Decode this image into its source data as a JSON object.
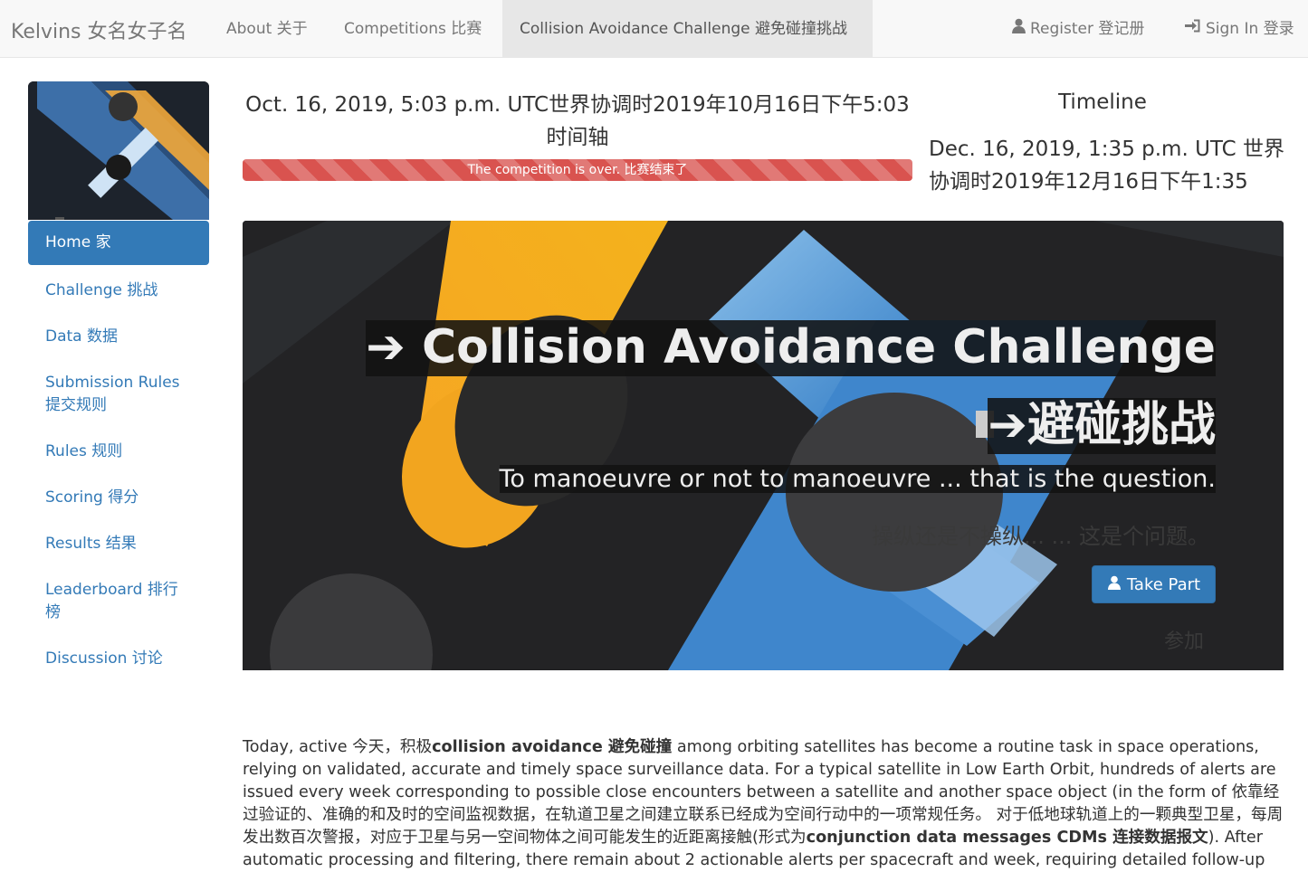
{
  "navbar": {
    "brand": "Kelvins 女名女子名",
    "about": "About 关于",
    "competitions": "Competitions 比赛",
    "current": "Collision Avoidance Challenge 避免碰撞挑战",
    "register": "Register 登记册",
    "sign_in": "Sign In 登录"
  },
  "sidebar": {
    "items": [
      {
        "label": "Home 家"
      },
      {
        "label": "Challenge 挑战"
      },
      {
        "label": "Data 数据"
      },
      {
        "label": "Submission Rules 提交规则"
      },
      {
        "label": "Rules 规则"
      },
      {
        "label": "Scoring 得分"
      },
      {
        "label": "Results 结果"
      },
      {
        "label": "Leaderboard 排行榜"
      },
      {
        "label": "Discussion 讨论"
      }
    ]
  },
  "timeline": {
    "start": "Oct. 16, 2019, 5:03 p.m. UTC世界协调时2019年10月16日下午5:03 时间轴",
    "status": "The competition is over. 比赛结束了",
    "title": "Timeline",
    "end": "Dec. 16, 2019, 1:35 p.m. UTC 世界协调时2019年12月16日下午1:35"
  },
  "hero": {
    "title": "➔ Collision Avoidance Challenge ➔避碰挑战",
    "subtitle": "To manoeuvre or not to manoeuvre ... that is the question.",
    "subtitle_zh": "操纵还是不操纵... ... 这是个问题。",
    "cta": "Take Part",
    "cta_zh": "参加"
  },
  "intro": {
    "p1a": "Today, active 今天，积极",
    "b1": "collision avoidance 避免碰撞",
    "p1b": " among orbiting satellites has become a routine task in space operations, relying on validated, accurate and timely space surveillance data. For a typical satellite in Low Earth Orbit, hundreds of alerts are issued every week corresponding to possible close encounters between a satellite and another space object (in the form of 依靠经过验证的、准确的和及时的空间监视数据，在轨道卫星之间建立联系已经成为空间行动中的一项常规任务。 对于低地球轨道上的一颗典型卫星，每周发出数百次警报，对应于卫星与另一空间物体之间可能发生的近距离接触(形式为",
    "b2": "conjunction data messages CDMs 连接数据报文",
    "p1c": "). After automatic processing and filtering, there remain about 2 actionable alerts per spacecraft and week, requiring detailed follow-up"
  },
  "colors": {
    "primary": "#337ab7",
    "danger": "#d9534f",
    "hero_bg": "#232325",
    "hero_orange": "#f5a623",
    "hero_blue": "#4a90d9"
  }
}
